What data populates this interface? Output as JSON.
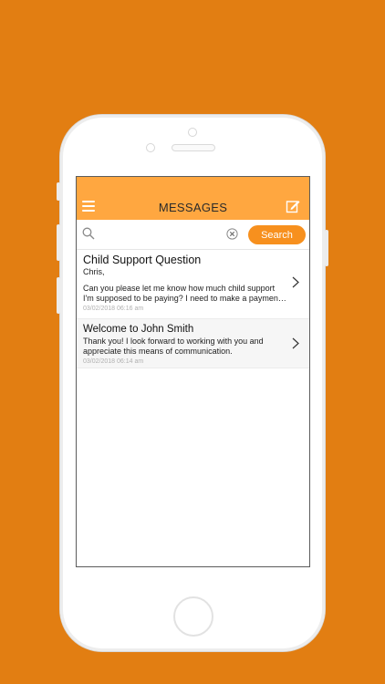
{
  "header": {
    "title": "MESSAGES",
    "menu_icon": "hamburger-menu-icon",
    "compose_icon": "compose-icon"
  },
  "search": {
    "placeholder": "",
    "value": "",
    "button_label": "Search"
  },
  "messages": [
    {
      "title": "Child Support Question",
      "salutation": "Chris,",
      "line1": "Can you please let me know how much child support",
      "line2": "I'm supposed to be paying?  I need to make a paymen…",
      "date": "03/02/2018 06:16 am"
    },
    {
      "title": "Welcome to John Smith",
      "line1": "Thank you!  I look forward to working with you and",
      "line2": "appreciate this means of communication.",
      "date": "03/02/2018 06:14 am"
    }
  ],
  "colors": {
    "background": "#E27E12",
    "header": "#FFA740",
    "accent": "#F7901E"
  }
}
